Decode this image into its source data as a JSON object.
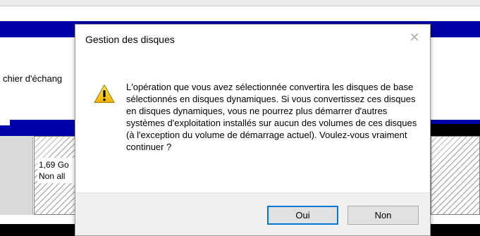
{
  "background": {
    "partial_text": "chier d'échang",
    "disk_info_line1": "1,69 Go",
    "disk_info_line2": "Non all"
  },
  "dialog": {
    "title": "Gestion des disques",
    "close_glyph": "✕",
    "icon": "warning-icon",
    "message": "L'opération que vous avez sélectionnée convertira les disques de base sélectionnés en disques dynamiques. Si vous convertissez ces disques en disques dynamiques, vous ne pourrez plus démarrer d'autres systèmes d'exploitation installés sur aucun des volumes de ces disques (à l'exception du volume de démarrage actuel). Voulez-vous vraiment continuer ?",
    "buttons": {
      "yes": "Oui",
      "no": "Non"
    },
    "accent_color": "#0078d7"
  }
}
